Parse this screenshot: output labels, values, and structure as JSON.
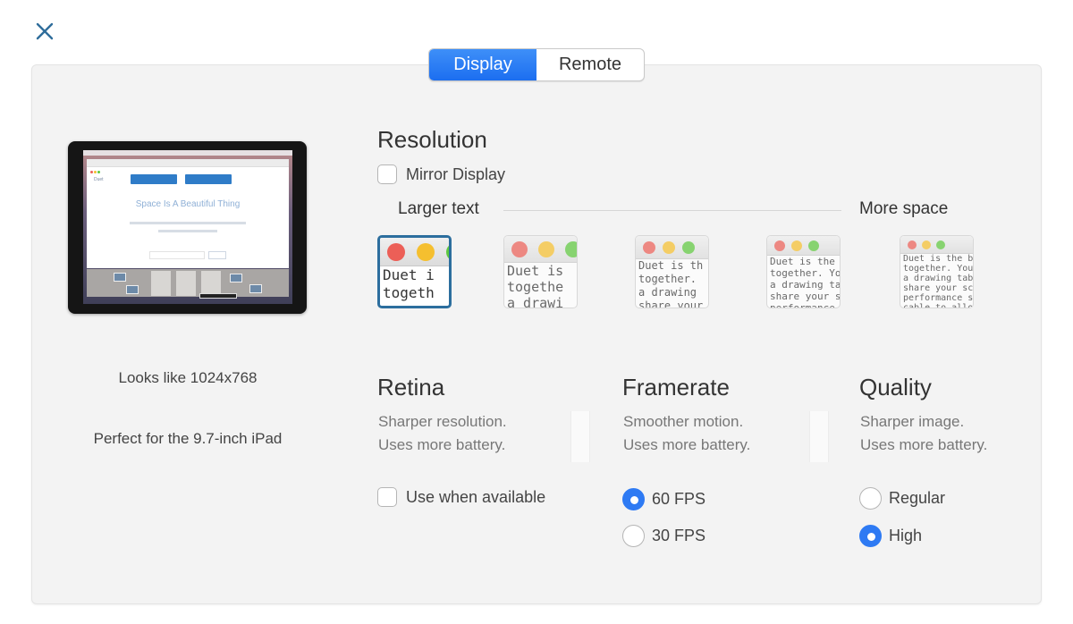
{
  "window": {
    "close_icon": "close-x-icon",
    "accent_color": "#2e7af3"
  },
  "tabs": [
    {
      "label": "Display",
      "active": true
    },
    {
      "label": "Remote",
      "active": false
    }
  ],
  "device": {
    "preview_headline": "Space Is A Beautiful Thing",
    "looks_like": "Looks like 1024x768",
    "perfect_for": "Perfect for the 9.7-inch iPad"
  },
  "resolution": {
    "title": "Resolution",
    "mirror_label": "Mirror Display",
    "mirror_checked": false,
    "larger_text_label": "Larger text",
    "more_space_label": "More space",
    "selected_index": 0,
    "options": [
      {
        "text": "Duet i\ntogeth"
      },
      {
        "text": "Duet is\ntogethe\na drawi"
      },
      {
        "text": "Duet is th\ntogether.\na drawing\nshare your"
      },
      {
        "text": "Duet is the\ntogether. Yo\na drawing ta\nshare your s\nperformance"
      },
      {
        "text": "Duet is the be\ntogether. You\na drawing tabl\nshare your scr\nperformance sc\ncable to allow"
      }
    ]
  },
  "retina": {
    "title": "Retina",
    "desc1": "Sharper resolution.",
    "desc2": "Uses more battery.",
    "checkbox_label": "Use when available",
    "checked": false
  },
  "framerate": {
    "title": "Framerate",
    "desc1": "Smoother motion.",
    "desc2": "Uses more battery.",
    "options": [
      {
        "label": "60 FPS",
        "selected": true
      },
      {
        "label": "30 FPS",
        "selected": false
      }
    ]
  },
  "quality": {
    "title": "Quality",
    "desc1": "Sharper image.",
    "desc2": "Uses more battery.",
    "options": [
      {
        "label": "Regular",
        "selected": false
      },
      {
        "label": "High",
        "selected": true
      }
    ]
  }
}
